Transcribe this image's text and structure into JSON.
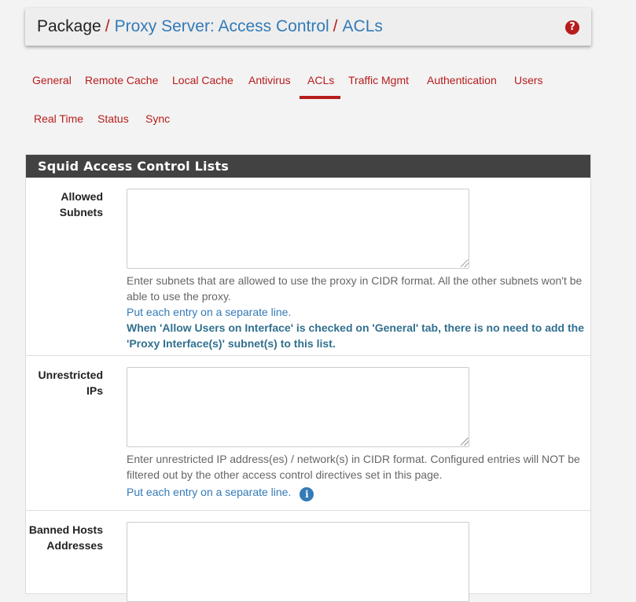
{
  "breadcrumb": {
    "root": "Package",
    "separator": "/",
    "items": [
      "Proxy Server: Access Control",
      "ACLs"
    ]
  },
  "help_icon": "?",
  "tabs_row1": [
    "General",
    "Remote Cache",
    "Local Cache",
    "Antivirus",
    "ACLs",
    "Traffic Mgmt",
    "Authentication",
    "Users"
  ],
  "tabs_row2": [
    "Real Time",
    "Status",
    "Sync"
  ],
  "active_tab": "ACLs",
  "panel": {
    "heading": "Squid Access Control Lists",
    "fields": [
      {
        "label": "Allowed Subnets",
        "value": "",
        "help": "Enter subnets that are allowed to use the proxy in CIDR format. All the other subnets won't be able to use the proxy.",
        "help2": "Put each entry on a separate line.",
        "help3": "When 'Allow Users on Interface' is checked on 'General' tab, there is no need to add the 'Proxy Interface(s)' subnet(s) to this list."
      },
      {
        "label": "Unrestricted IPs",
        "value": "",
        "help": "Enter unrestricted IP address(es) / network(s) in CIDR format. Configured entries will NOT be filtered out by the other access control directives set in this page.",
        "help2": "Put each entry on a separate line.",
        "info_icon": "i"
      },
      {
        "label": "Banned Hosts Addresses",
        "value": ""
      }
    ]
  },
  "colors": {
    "accent": "#b71c1c",
    "link": "#337ab7",
    "heading_bg": "#424242"
  }
}
